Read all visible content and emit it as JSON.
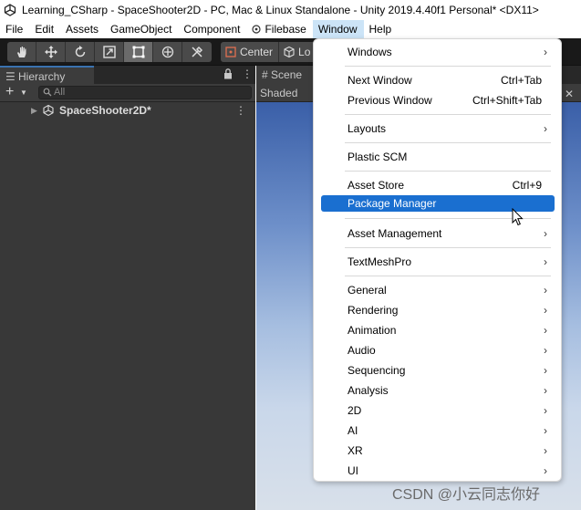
{
  "window": {
    "title": "Learning_CSharp - SpaceShooter2D - PC, Mac & Linux Standalone - Unity 2019.4.40f1 Personal* <DX11>",
    "logo_icon": "unity-logo-icon"
  },
  "menubar": {
    "items": [
      "File",
      "Edit",
      "Assets",
      "GameObject",
      "Component",
      "Filebase",
      "Window",
      "Help"
    ],
    "active": "Window"
  },
  "toolbar": {
    "tools": [
      "hand-icon",
      "move-icon",
      "rotate-icon",
      "scale-icon",
      "rect-tool-icon",
      "transform-icon",
      "custom-tool-icon"
    ],
    "active_tool": "rect-tool-icon",
    "pivot_label": "Center",
    "handle_label": "Lo"
  },
  "hierarchy": {
    "tab_label": "Hierarchy",
    "search_placeholder": "All",
    "scene_name": "SpaceShooter2D*"
  },
  "scene": {
    "tab_label": "Scene",
    "shading_mode": "Shaded"
  },
  "window_menu": {
    "items": [
      {
        "label": "Windows",
        "submenu": true
      },
      {
        "label": "Next Window",
        "shortcut": "Ctrl+Tab"
      },
      {
        "label": "Previous Window",
        "shortcut": "Ctrl+Shift+Tab"
      },
      {
        "label": "Layouts",
        "submenu": true
      },
      {
        "label": "Plastic SCM"
      },
      {
        "label": "Asset Store",
        "shortcut": "Ctrl+9"
      },
      {
        "label": "Package Manager",
        "highlighted": true
      },
      {
        "label": "Asset Management",
        "submenu": true
      },
      {
        "label": "TextMeshPro",
        "submenu": true
      },
      {
        "label": "General",
        "submenu": true
      },
      {
        "label": "Rendering",
        "submenu": true
      },
      {
        "label": "Animation",
        "submenu": true
      },
      {
        "label": "Audio",
        "submenu": true
      },
      {
        "label": "Sequencing",
        "submenu": true
      },
      {
        "label": "Analysis",
        "submenu": true
      },
      {
        "label": "2D",
        "submenu": true
      },
      {
        "label": "AI",
        "submenu": true
      },
      {
        "label": "XR",
        "submenu": true
      },
      {
        "label": "UI",
        "submenu": true
      }
    ],
    "submenu_glyph": "›"
  },
  "watermark": "CSDN @小云同志你好",
  "colors": {
    "highlight": "#1a6fd0",
    "menu_active": "#cce4f7",
    "panel": "#383838",
    "toolbar": "#191919"
  }
}
